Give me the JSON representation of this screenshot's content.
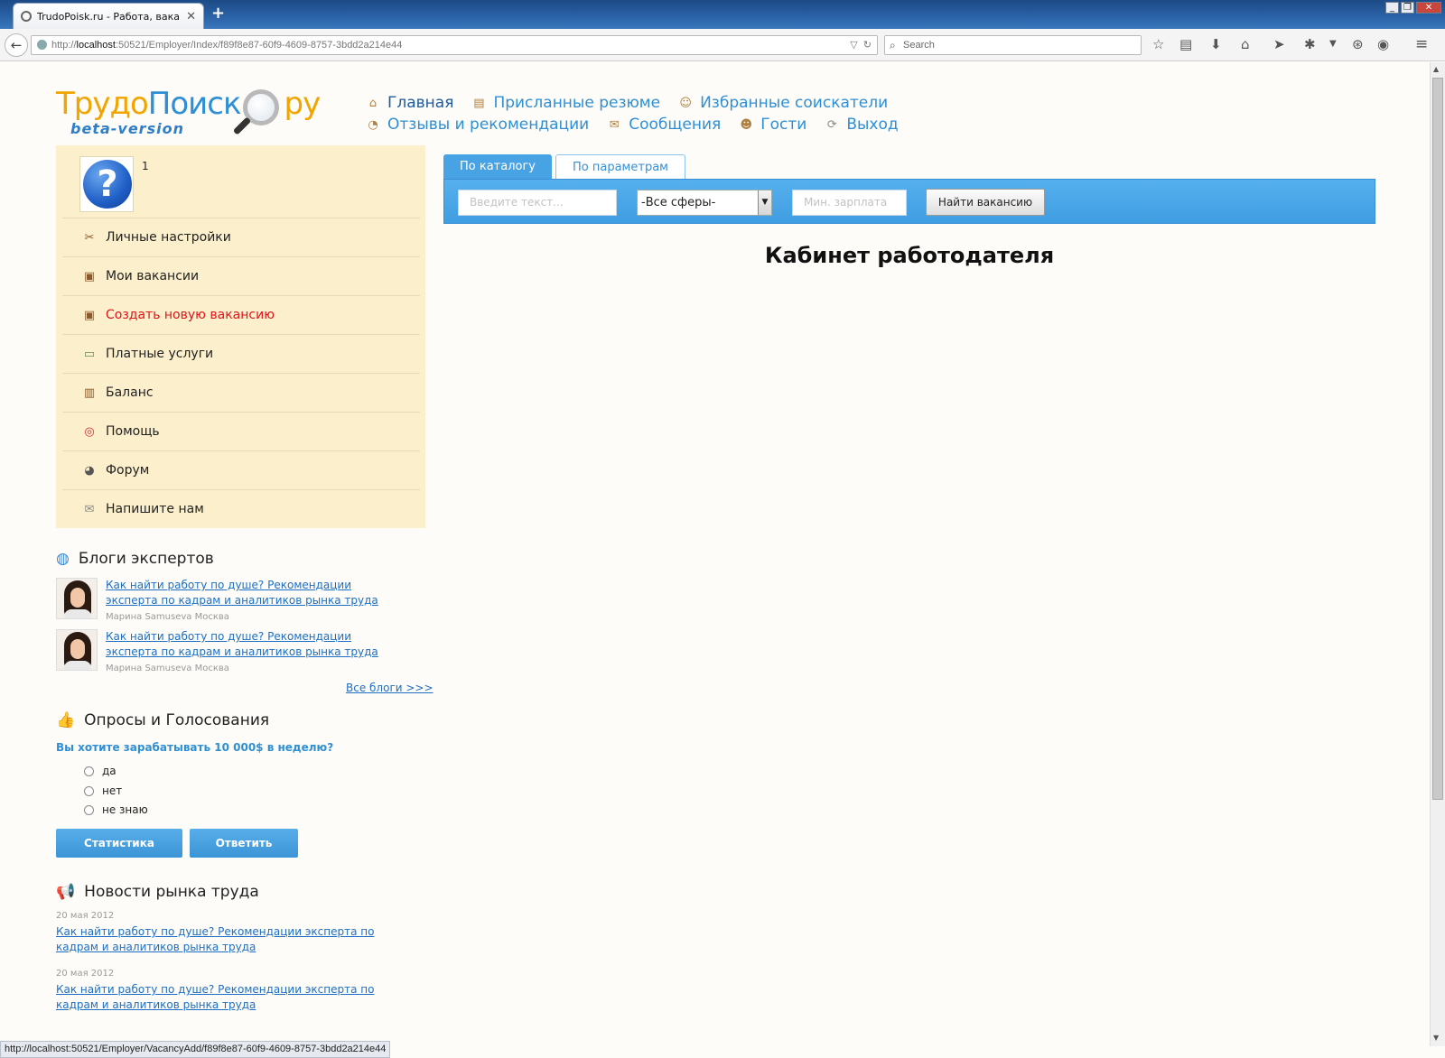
{
  "browser": {
    "tab_title": "TrudoPoisk.ru - Работа, вака...",
    "new_tab": "+",
    "url_prefix": "http://",
    "url_host": "localhost",
    "url_rest": ":50521/Employer/Index/f89f8e87-60f9-4609-8757-3bdd2a214e44",
    "search_placeholder": "Search",
    "status_url": "http://localhost:50521/Employer/VacancyAdd/f89f8e87-60f9-4609-8757-3bdd2a214e44"
  },
  "logo": {
    "part1": "Трудо",
    "part2": "Поиск",
    "part3": "ру",
    "beta": "beta-version"
  },
  "topnav": {
    "row1": [
      {
        "label": "Главная",
        "icon": "home-icon"
      },
      {
        "label": "Присланные резюме",
        "icon": "document-icon"
      },
      {
        "label": "Избранные соискатели",
        "icon": "person-icon"
      }
    ],
    "row2": [
      {
        "label": "Отзывы и рекомендации",
        "icon": "chat-icon"
      },
      {
        "label": "Сообщения",
        "icon": "envelope-icon"
      },
      {
        "label": "Гости",
        "icon": "users-icon"
      },
      {
        "label": "Выход",
        "icon": "logout-icon"
      }
    ]
  },
  "profile": {
    "name": "1",
    "avatar_glyph": "?"
  },
  "menu": [
    {
      "label": "Личные настройки",
      "icon": "tools-icon"
    },
    {
      "label": "Мои вакансии",
      "icon": "briefcase-icon"
    },
    {
      "label": "Создать новую вакансию",
      "icon": "briefcase-add-icon"
    },
    {
      "label": "Платные услуги",
      "icon": "money-icon"
    },
    {
      "label": "Баланс",
      "icon": "wallet-icon"
    },
    {
      "label": "Помощь",
      "icon": "lifebuoy-icon"
    },
    {
      "label": "Форум",
      "icon": "forum-icon"
    },
    {
      "label": "Напишите нам",
      "icon": "mail-icon"
    }
  ],
  "blogs": {
    "title": "Блоги экспертов",
    "items": [
      {
        "text": "Как найти работу по душе? Рекомендации эксперта по кадрам и аналитиков рынка труда",
        "author": "Марина Samuseva Москва"
      },
      {
        "text": "Как найти работу по душе? Рекомендации эксперта по кадрам и аналитиков рынка труда",
        "author": "Марина Samuseva Москва"
      }
    ],
    "all_link": "Все блоги >>>"
  },
  "poll": {
    "title": "Опросы и Голосования",
    "question": "Вы хотите зарабатывать 10 000$ в неделю?",
    "options": [
      "да",
      "нет",
      "не знаю"
    ],
    "stats_button": "Статистика",
    "answer_button": "Ответить"
  },
  "news": {
    "title": "Новости рынка труда",
    "items": [
      {
        "date": "20 мая 2012",
        "text": "Как найти работу по душе? Рекомендации эксперта по кадрам и аналитиков рынка труда"
      },
      {
        "date": "20 мая 2012",
        "text": "Как найти работу по душе? Рекомендации эксперта по кадрам и аналитиков рынка труда"
      }
    ]
  },
  "search": {
    "tab_catalog": "По каталогу",
    "tab_params": "По параметрам",
    "text_placeholder": "Введите текст...",
    "sphere_selected": "-Все сферы-",
    "salary_placeholder": "Мин. зарплата",
    "find_button": "Найти вакансию"
  },
  "main": {
    "title": "Кабинет работодателя"
  }
}
